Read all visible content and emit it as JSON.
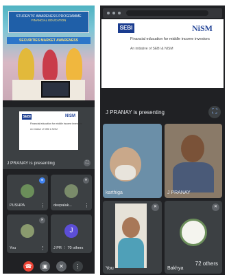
{
  "left_panel": {
    "photo": {
      "banner_line1": "STUDENTS' AWARENESS PROGRAMME",
      "banner_line2": "FINANCIAL EDUCATION",
      "banner_strip": "SECURITIES MARKET AWARENESS"
    },
    "slide": {
      "logo_left": "SEBI",
      "logo_right": "NISM",
      "line1": "Financial education for middle income investors",
      "line2": "An initiative of SEBI & NISM"
    },
    "presenting_label": "J PRANAY is presenting",
    "participants": [
      {
        "name": "PUSHPA",
        "avatar_color": "#6b8e5a"
      },
      {
        "name": "deepalak...",
        "avatar_color": "#7a8b6a"
      },
      {
        "name": "You",
        "avatar_color": "#8a9a6e"
      },
      {
        "name": "J PR",
        "avatar_letter": "J",
        "avatar_color": "#5c4ed6",
        "others_label": "70 others"
      }
    ],
    "controls": [
      "end-call",
      "camera",
      "mic",
      "more"
    ]
  },
  "right_panel": {
    "slide": {
      "logo_left": "SEBI",
      "logo_right": "NiSM",
      "line1": "Financial education for middle income investors",
      "line2": "An initiative of SEBI & NISM"
    },
    "presenting_label": "J PRANAY is presenting",
    "participants": [
      {
        "name": "karthiga"
      },
      {
        "name": "J PRANAY"
      },
      {
        "name": "You"
      },
      {
        "name": "Bakhya",
        "others_label": "72 others"
      }
    ]
  },
  "colors": {
    "meet_bg": "#202124",
    "tile_bg": "#3c4043",
    "end_call": "#ea4335",
    "accent": "#8ab4f8"
  }
}
